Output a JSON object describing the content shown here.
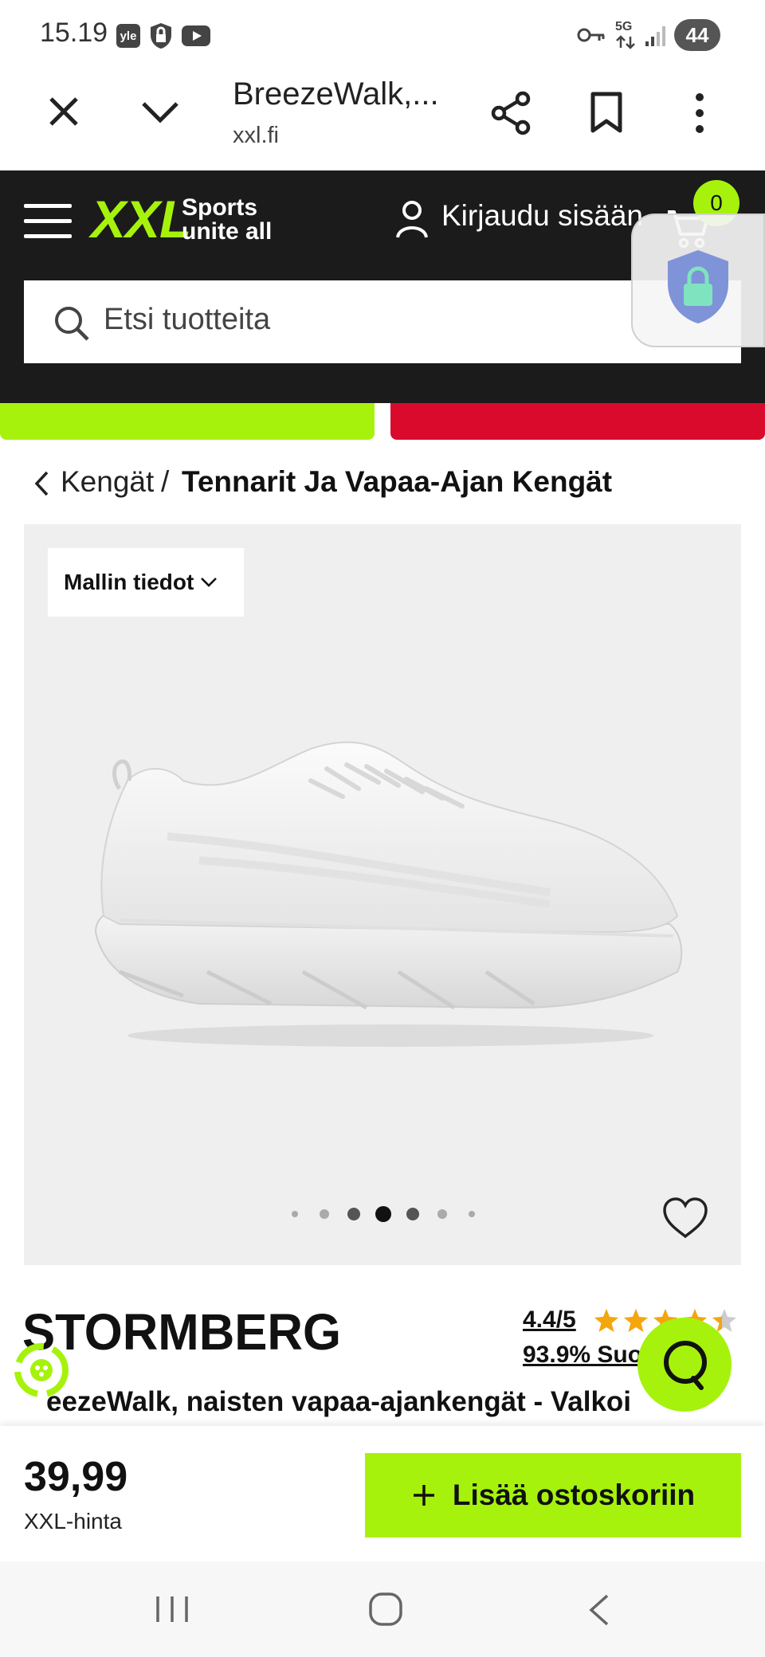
{
  "status_bar": {
    "time": "15.19",
    "badge_yle": "yle",
    "network": "5G",
    "battery": "44"
  },
  "browser": {
    "title": "BreezeWalk,...",
    "url": "xxl.fi"
  },
  "header": {
    "logo_text": "XXL",
    "tagline_line1": "Sports",
    "tagline_line2": "unite all",
    "login_label": "Kirjaudu sisään",
    "cart_count": "0",
    "search_placeholder": "Etsi tuotteita"
  },
  "breadcrumb": {
    "parent": "Kengät",
    "separator": "/",
    "current": "Tennarit Ja Vapaa-Ajan Kengät"
  },
  "gallery": {
    "model_info_label": "Mallin tiedot",
    "image_count": 7,
    "active_index": 3
  },
  "product": {
    "brand": "STORMBERG",
    "rating": "4.4/5",
    "rating_stars": 4.4,
    "recommend": "93.9% Suo",
    "title": "eezeWalk, naisten vapaa-ajankengät - Valkoi"
  },
  "buy_bar": {
    "price": "39,99",
    "price_label": "XXL-hinta",
    "add_to_cart_label": "Lisää ostoskoriin"
  },
  "colors": {
    "brand_green": "#a6f20d",
    "header_dark": "#1b1b1b",
    "promo_red": "#d90a2c",
    "star_orange": "#f4a60d"
  }
}
